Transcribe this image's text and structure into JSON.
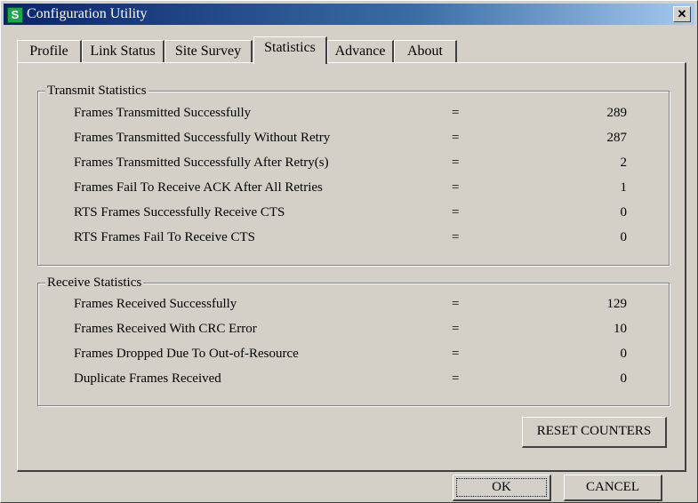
{
  "window": {
    "title": "Configuration Utility",
    "close_glyph": "✕",
    "app_icon_glyph": "S"
  },
  "tabs": [
    {
      "label": "Profile"
    },
    {
      "label": "Link Status"
    },
    {
      "label": "Site Survey"
    },
    {
      "label": "Statistics",
      "active": true
    },
    {
      "label": "Advance"
    },
    {
      "label": "About"
    }
  ],
  "transmit": {
    "title": "Transmit Statistics",
    "rows": [
      {
        "label": "Frames Transmitted Successfully",
        "eq": "=",
        "value": "289"
      },
      {
        "label": "Frames Transmitted Successfully  Without Retry",
        "eq": "=",
        "value": "287"
      },
      {
        "label": "Frames Transmitted Successfully After Retry(s)",
        "eq": "=",
        "value": "2"
      },
      {
        "label": "Frames Fail To Receive ACK After All Retries",
        "eq": "=",
        "value": "1"
      },
      {
        "label": "RTS Frames Successfully Receive CTS",
        "eq": "=",
        "value": "0"
      },
      {
        "label": "RTS Frames Fail To Receive CTS",
        "eq": "=",
        "value": "0"
      }
    ]
  },
  "receive": {
    "title": "Receive Statistics",
    "rows": [
      {
        "label": "Frames Received Successfully",
        "eq": "=",
        "value": "129"
      },
      {
        "label": "Frames Received  With CRC Error",
        "eq": "=",
        "value": "10"
      },
      {
        "label": "Frames Dropped Due To Out-of-Resource",
        "eq": "=",
        "value": "0"
      },
      {
        "label": "Duplicate Frames Received",
        "eq": "=",
        "value": "0"
      }
    ]
  },
  "buttons": {
    "reset": "RESET COUNTERS",
    "ok": "OK",
    "cancel": "CANCEL"
  }
}
